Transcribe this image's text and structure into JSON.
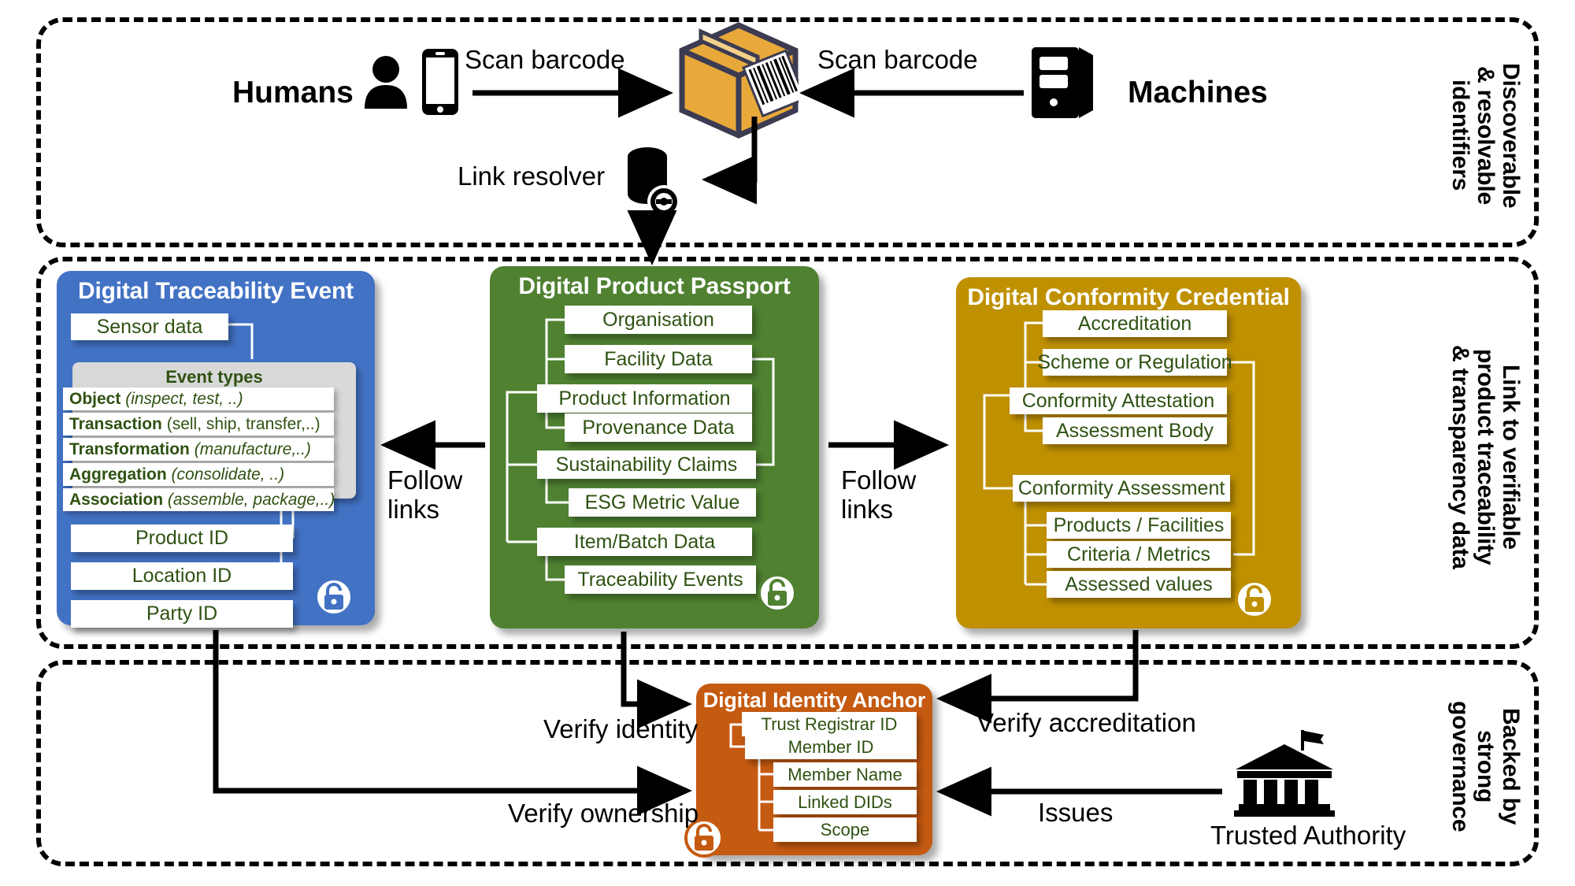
{
  "sections": [
    {
      "id": "discoverable",
      "label": "Discoverable\n& resolvable\nidentifiers"
    },
    {
      "id": "link",
      "label": "Link to verifiable\nproduct traceability\n& transparency data"
    },
    {
      "id": "governance",
      "label": "Backed by\nstrong\ngovernance"
    }
  ],
  "top": {
    "humans_label": "Humans",
    "machines_label": "Machines",
    "resolver_label": "Link resolver",
    "scan_left_label": "Scan barcode",
    "scan_right_label": "Scan barcode",
    "icons": {
      "person": "person-icon",
      "phone": "mobile-phone-icon",
      "server": "server-icon",
      "box": "barcoded-package-icon",
      "database": "database-link-icon"
    }
  },
  "flows": {
    "follow_links_left": "Follow\nlinks",
    "follow_links_right": "Follow\nlinks",
    "verify_identity": "Verify identity",
    "verify_ownership": "Verify ownership",
    "verify_accreditation": "Verify accreditation",
    "issues": "Issues"
  },
  "cards": {
    "dte": {
      "title": "Digital Traceability Event",
      "color": "#4272C4",
      "sensor": "Sensor data",
      "event_types_title": "Event types",
      "event_types": [
        {
          "name": "Object",
          "examples": "(inspect, test, ..)"
        },
        {
          "name": "Transaction",
          "examples": "(sell, ship, transfer,..)"
        },
        {
          "name": "Transformation",
          "examples": "(manufacture,..)"
        },
        {
          "name": "Aggregation",
          "examples": "(consolidate, ..)"
        },
        {
          "name": "Association",
          "examples": "(assemble, package,..)"
        }
      ],
      "ids": [
        "Product ID",
        "Location ID",
        "Party ID"
      ]
    },
    "dpp": {
      "title": "Digital Product Passport",
      "color": "#4F8131",
      "rows": [
        "Organisation",
        "Facility Data",
        "Product Information",
        "Provenance Data",
        "Sustainability Claims",
        "ESG Metric Value",
        "Item/Batch Data",
        "Traceability Events"
      ]
    },
    "dcc": {
      "title": "Digital Conformity Credential",
      "color": "#BF9000",
      "rows": [
        "Accreditation",
        "Scheme or Regulation",
        "Conformity Attestation",
        "Assessment Body",
        "Conformity Assessment",
        "Products / Facilities",
        "Criteria / Metrics",
        "Assessed values"
      ]
    },
    "dia": {
      "title": "Digital Identity Anchor",
      "color": "#C55A11",
      "rows": [
        "Trust Registrar ID",
        "Member ID",
        "Member Name",
        "Linked DIDs",
        "Scope"
      ]
    }
  },
  "bottom": {
    "trusted_authority_label": "Trusted Authority",
    "bank_icon": "classical-bank-building-icon"
  }
}
